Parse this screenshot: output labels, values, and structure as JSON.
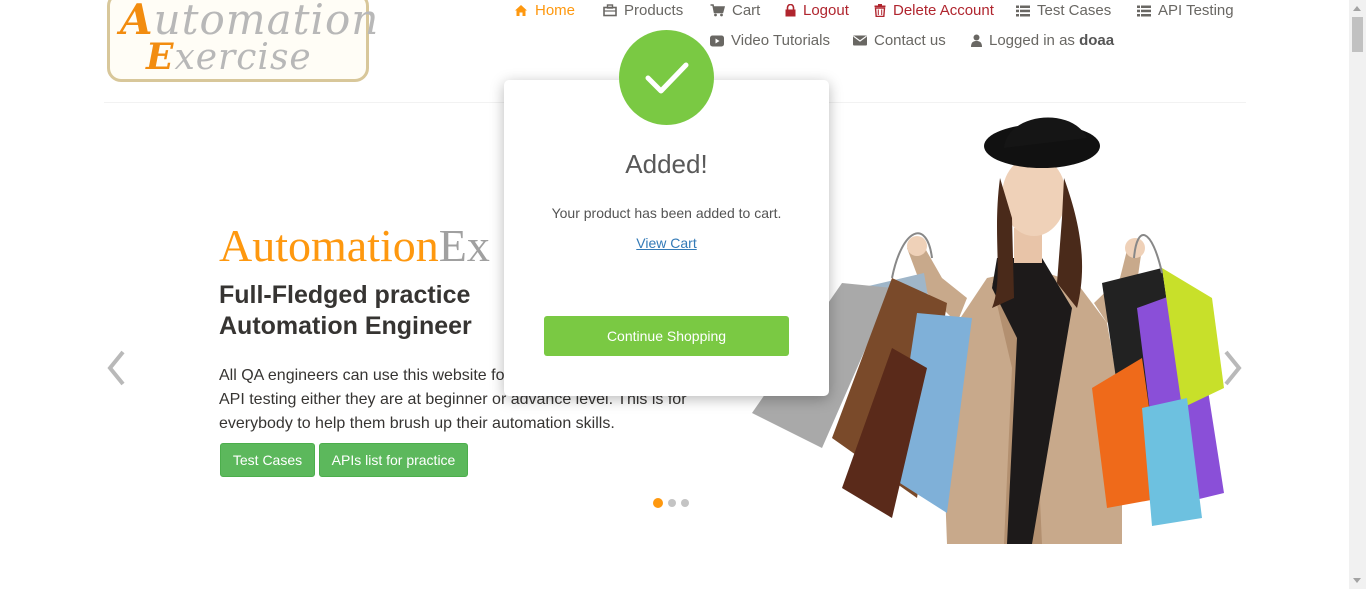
{
  "logo": {
    "line1_cap": "A",
    "line1_rest": "utomation",
    "line2_cap": "E",
    "line2_rest": "xercise"
  },
  "nav": {
    "home": "Home",
    "products": "Products",
    "cart": "Cart",
    "logout": "Logout",
    "delete_account": "Delete Account",
    "test_cases": "Test Cases",
    "api_testing": "API Testing",
    "video_tutorials": "Video Tutorials",
    "contact_us": "Contact us",
    "logged_in_prefix": "Logged in as",
    "username": "doaa"
  },
  "hero": {
    "title_part1": "Automation",
    "title_part2": "Ex",
    "subtitle_line1": "Full-Fledged practice",
    "subtitle_line2": "Automation Engineer",
    "desc_line1": "All QA engineers can use this website fo",
    "desc_line2": "API testing either they are at beginner or advance level. This is for",
    "desc_line3": "everybody to help them brush up their automation skills.",
    "btn_test_cases": "Test Cases",
    "btn_apis": "APIs list for practice",
    "slides": 3,
    "active_slide": 1
  },
  "modal": {
    "title": "Added!",
    "message": "Your product has been added to cart.",
    "link": "View Cart",
    "button": "Continue Shopping"
  },
  "colors": {
    "accent_orange": "#fe980f",
    "danger_red": "#b0252e",
    "button_green": "#5cb85c",
    "modal_green": "#7ac943",
    "link_blue": "#337ab7"
  },
  "icons": {
    "home": "home-icon",
    "products": "briefcase-icon",
    "cart": "shopping-cart-icon",
    "logout": "lock-icon",
    "delete": "trash-icon",
    "test_cases": "list-icon",
    "api_testing": "list-icon",
    "video": "youtube-play-icon",
    "contact": "envelope-icon",
    "user": "user-icon",
    "success": "checkmark-icon",
    "prev": "chevron-left-icon",
    "next": "chevron-right-icon"
  }
}
